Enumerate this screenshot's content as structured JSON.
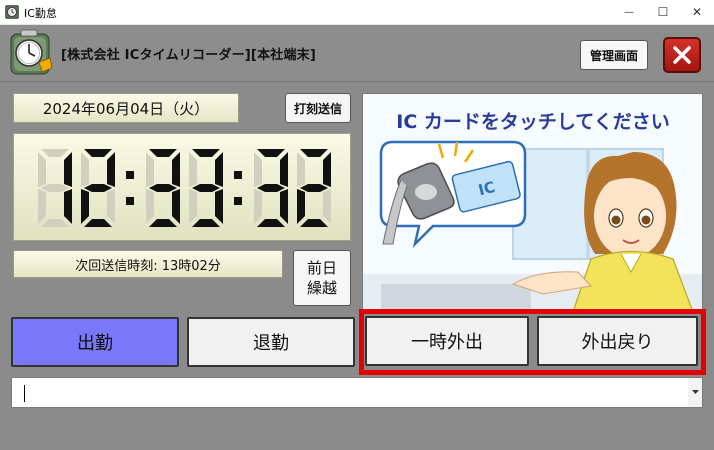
{
  "window": {
    "title": "IC勤怠",
    "minimize_glyph": "—",
    "maximize_glyph": "☐",
    "close_glyph": "✕"
  },
  "header": {
    "company": "[株式会社 ICタイムリコーダー][本社端末]",
    "admin_button": "管理画面"
  },
  "status": {
    "date": "2024年06月04日（火）",
    "send_button": "打刻送信",
    "clock": {
      "hh": "12",
      "mm": "33",
      "ss": "32"
    },
    "next_send": "次回送信時刻: 13時02分",
    "prev_day_line1": "前日",
    "prev_day_line2": "繰越"
  },
  "banner": {
    "message": "IC カードをタッチしてください",
    "card_label": "IC"
  },
  "actions": {
    "clock_in": "出勤",
    "clock_out": "退勤",
    "temp_out": "一時外出",
    "return": "外出戻り"
  },
  "input": {
    "value": ""
  },
  "icons": {
    "app": "clock-app-icon",
    "logo": "clock-logo-icon",
    "close": "close-x-icon",
    "dropdown": "dropdown-arrow-icon"
  },
  "colors": {
    "client_bg": "#8b8b8b",
    "clock_in_bg": "#7878f8",
    "highlight_frame": "#e40000",
    "close_red": "#c0241d"
  }
}
